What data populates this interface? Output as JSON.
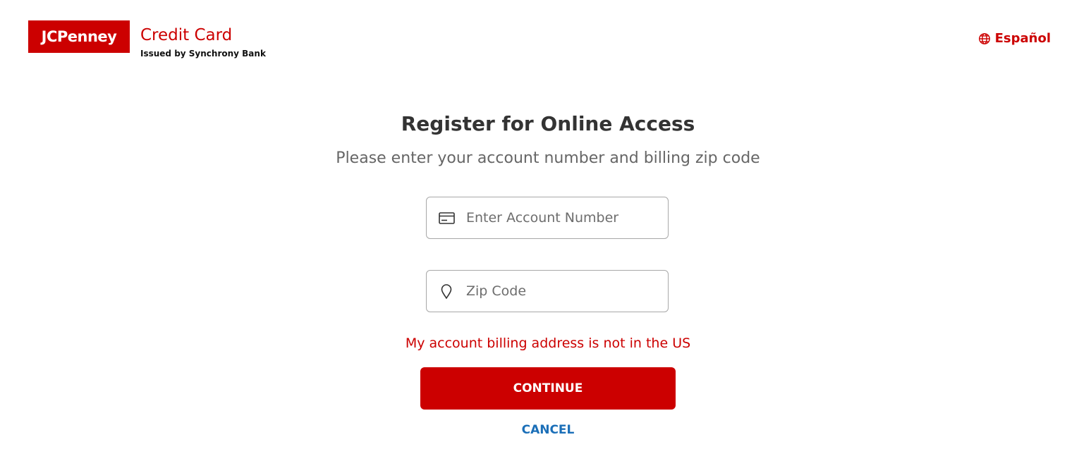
{
  "header": {
    "logo_text": "JCPenney",
    "brand_title": "Credit Card",
    "brand_subtitle": "Issued by Synchrony Bank",
    "language_link": "Español",
    "language_icon": "globe-icon"
  },
  "main": {
    "heading": "Register for Online Access",
    "subheading": "Please enter your account number and billing zip code",
    "account_field": {
      "placeholder": "Enter Account Number",
      "value": "",
      "icon": "credit-card-icon"
    },
    "zip_field": {
      "placeholder": "Zip Code",
      "value": "",
      "icon": "location-pin-icon"
    },
    "non_us_link": "My account billing address is not in the US",
    "continue_label": "CONTINUE",
    "cancel_label": "CANCEL"
  },
  "colors": {
    "brand_red": "#cc0000",
    "link_blue": "#1b6fb8",
    "heading_text": "#333333",
    "subheading_text": "#666666"
  }
}
